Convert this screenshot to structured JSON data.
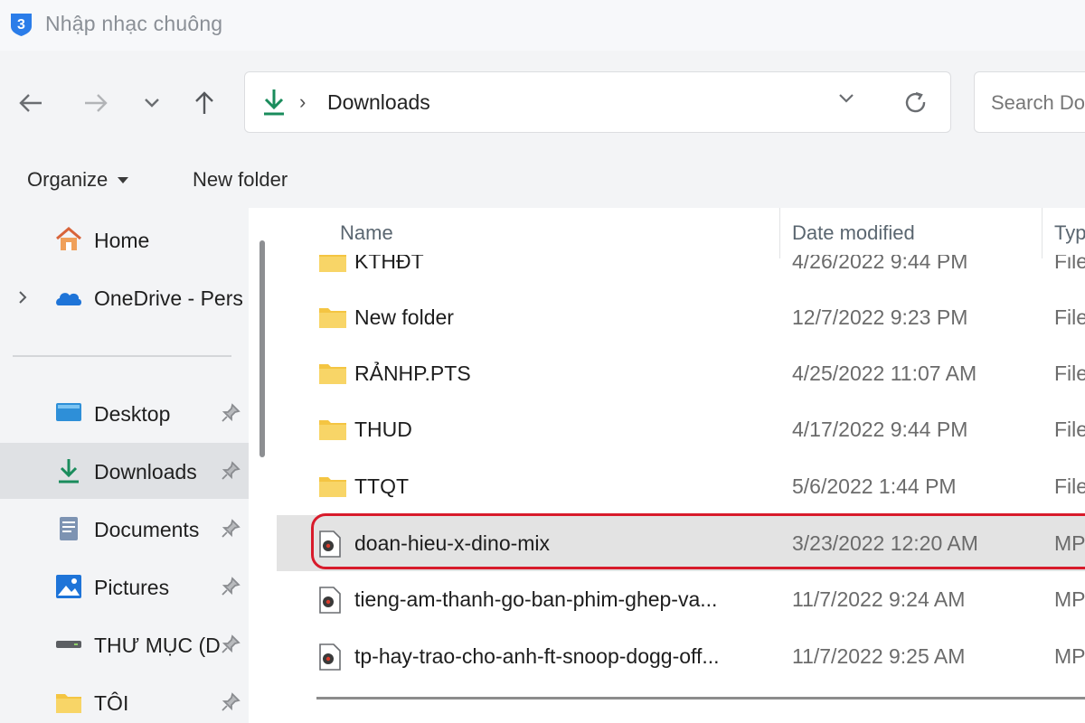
{
  "window": {
    "title": "Nhập nhạc chuông"
  },
  "address": {
    "current_folder": "Downloads",
    "separator": "›"
  },
  "search": {
    "placeholder": "Search Do"
  },
  "commands": {
    "organize": "Organize",
    "new_folder": "New folder"
  },
  "sidebar": {
    "items": [
      {
        "label": "Home",
        "icon": "home-icon"
      },
      {
        "label": "OneDrive - Pers",
        "icon": "onedrive-icon"
      },
      {
        "label": "Desktop",
        "icon": "desktop-icon",
        "pinned": true
      },
      {
        "label": "Downloads",
        "icon": "download-icon",
        "pinned": true,
        "selected": true
      },
      {
        "label": "Documents",
        "icon": "documents-icon",
        "pinned": true
      },
      {
        "label": "Pictures",
        "icon": "pictures-icon",
        "pinned": true
      },
      {
        "label": "THƯ MỤC (D",
        "icon": "drive-icon",
        "pinned": true
      },
      {
        "label": "TÔI",
        "icon": "folder-icon",
        "pinned": true
      }
    ]
  },
  "filelist": {
    "columns": {
      "name": "Name",
      "date": "Date modified",
      "type": "Typ"
    },
    "rows": [
      {
        "name": "KTHĐT",
        "date": "4/26/2022 9:44 PM",
        "type": "File",
        "icon": "folder-icon"
      },
      {
        "name": "New folder",
        "date": "12/7/2022 9:23 PM",
        "type": "File",
        "icon": "folder-icon"
      },
      {
        "name": "RẢNHP.PTS",
        "date": "4/25/2022 11:07 AM",
        "type": "File",
        "icon": "folder-icon"
      },
      {
        "name": "THUD",
        "date": "4/17/2022 9:44 PM",
        "type": "File",
        "icon": "folder-icon"
      },
      {
        "name": "TTQT",
        "date": "5/6/2022 1:44 PM",
        "type": "File",
        "icon": "folder-icon"
      },
      {
        "name": "doan-hieu-x-dino-mix",
        "date": "3/23/2022 12:20 AM",
        "type": "MP",
        "icon": "audio-file-icon",
        "selected": true
      },
      {
        "name": "tieng-am-thanh-go-ban-phim-ghep-va...",
        "date": "11/7/2022 9:24 AM",
        "type": "MP",
        "icon": "audio-file-icon"
      },
      {
        "name": "tp-hay-trao-cho-anh-ft-snoop-dogg-off...",
        "date": "11/7/2022 9:25 AM",
        "type": "MP",
        "icon": "audio-file-icon"
      }
    ]
  },
  "colors": {
    "highlight": "#d81b2b",
    "folder": "#f4c542",
    "accent": "#1a8c5c",
    "selection": "#e3e3e3"
  }
}
